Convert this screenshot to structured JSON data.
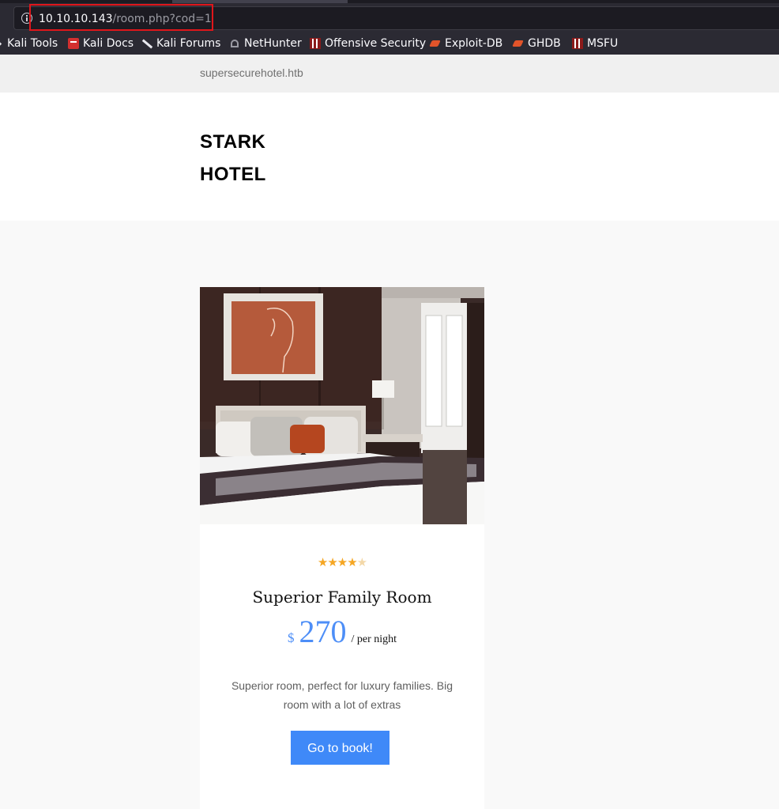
{
  "browser": {
    "url": {
      "host": "10.10.10.143",
      "path": "/room.php?cod=1"
    },
    "bookmarks": [
      {
        "label": "Kali Tools",
        "icon": "kali-tools-icon"
      },
      {
        "label": "Kali Docs",
        "icon": "kali-docs-icon"
      },
      {
        "label": "Kali Forums",
        "icon": "kali-forums-icon"
      },
      {
        "label": "NetHunter",
        "icon": "nethunter-icon"
      },
      {
        "label": "Offensive Security",
        "icon": "offensive-security-icon"
      },
      {
        "label": "Exploit-DB",
        "icon": "exploit-db-icon"
      },
      {
        "label": "GHDB",
        "icon": "ghdb-icon"
      },
      {
        "label": "MSFU",
        "icon": "msfu-icon"
      }
    ],
    "highlight_color": "#e0161b"
  },
  "site": {
    "domain": "supersecurehotel.htb",
    "brand_line1": "STARK",
    "brand_line2": "HOTEL"
  },
  "room": {
    "rating": 4,
    "rating_max": 5,
    "title": "Superior Family Room",
    "currency": "$",
    "price": "270",
    "per": "/ per night",
    "description": "Superior room, perfect for luxury families. Big room with a lot of extras",
    "button_label": "Go to book!",
    "accent_color": "#4d8ef7"
  }
}
